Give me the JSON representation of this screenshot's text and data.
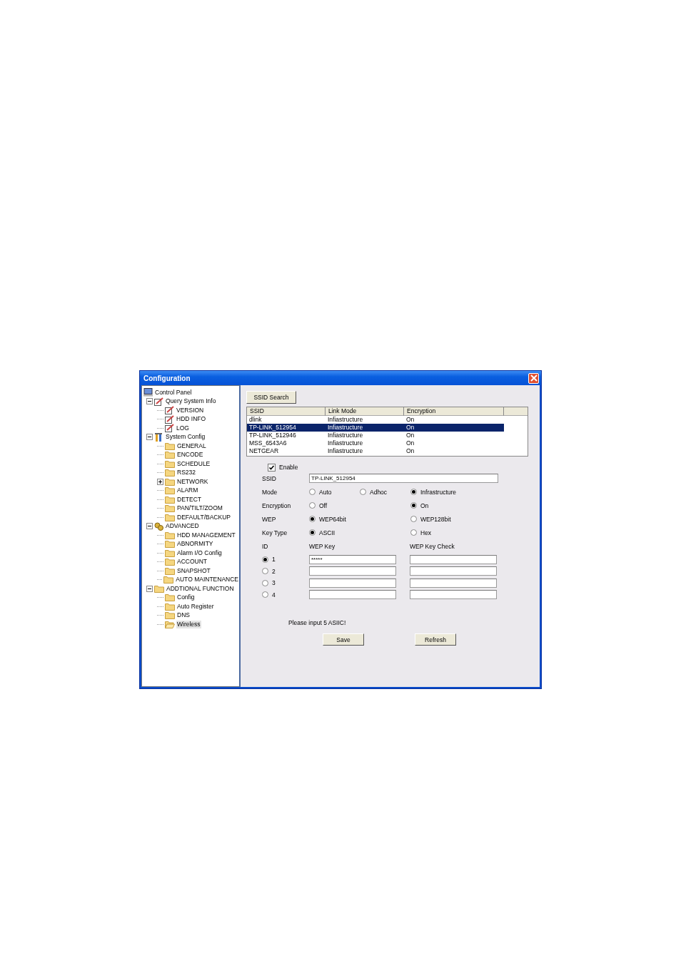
{
  "window": {
    "title": "Configuration"
  },
  "tree": [
    {
      "label": "Control Panel",
      "kind": "monitor",
      "selected": false,
      "children": [
        {
          "label": "Query System Info",
          "kind": "edit",
          "selected": false,
          "expanded": true,
          "children": [
            {
              "label": "VERSION",
              "kind": "edit",
              "selected": false
            },
            {
              "label": "HDD INFO",
              "kind": "edit",
              "selected": false
            },
            {
              "label": "LOG",
              "kind": "edit",
              "selected": false
            }
          ]
        },
        {
          "label": "System Config",
          "kind": "tools",
          "selected": false,
          "expanded": true,
          "children": [
            {
              "label": "GENERAL",
              "kind": "folder",
              "selected": false
            },
            {
              "label": "ENCODE",
              "kind": "folder",
              "selected": false
            },
            {
              "label": "SCHEDULE",
              "kind": "folder",
              "selected": false
            },
            {
              "label": "RS232",
              "kind": "folder",
              "selected": false
            },
            {
              "label": "NETWORK",
              "kind": "folder",
              "selected": false,
              "expanded": false
            },
            {
              "label": "ALARM",
              "kind": "folder",
              "selected": false
            },
            {
              "label": "DETECT",
              "kind": "folder",
              "selected": false
            },
            {
              "label": "PAN/TILT/ZOOM",
              "kind": "folder",
              "selected": false
            },
            {
              "label": "DEFAULT/BACKUP",
              "kind": "folder",
              "selected": false
            }
          ]
        },
        {
          "label": "ADVANCED",
          "kind": "gear",
          "selected": false,
          "expanded": true,
          "children": [
            {
              "label": "HDD MANAGEMENT",
              "kind": "folder",
              "selected": false
            },
            {
              "label": "ABNORMITY",
              "kind": "folder",
              "selected": false
            },
            {
              "label": "Alarm I/O Config",
              "kind": "folder",
              "selected": false
            },
            {
              "label": "ACCOUNT",
              "kind": "folder",
              "selected": false
            },
            {
              "label": "SNAPSHOT",
              "kind": "folder",
              "selected": false
            },
            {
              "label": "AUTO MAINTENANCE",
              "kind": "folder",
              "selected": false
            }
          ]
        },
        {
          "label": "ADDTIONAL FUNCTION",
          "kind": "folder",
          "selected": false,
          "expanded": true,
          "children": [
            {
              "label": "Config",
              "kind": "folder",
              "selected": false
            },
            {
              "label": "Auto Register",
              "kind": "folder",
              "selected": false
            },
            {
              "label": "DNS",
              "kind": "folder",
              "selected": false
            },
            {
              "label": "Wireless",
              "kind": "openfolder",
              "selected": true
            }
          ]
        }
      ]
    }
  ],
  "ssid_search_button": "SSID Search",
  "table": {
    "columns": [
      "SSID",
      "Link Mode",
      "Encryption"
    ],
    "rows": [
      {
        "cells": [
          "dlink",
          "Infiastructure",
          "On"
        ],
        "selected": false
      },
      {
        "cells": [
          "TP-LINK_512954",
          "Infiastructure",
          "On"
        ],
        "selected": true
      },
      {
        "cells": [
          "TP-LINK_512946",
          "Infiastructure",
          "On"
        ],
        "selected": false
      },
      {
        "cells": [
          "MSS_6543A6",
          "Infiastructure",
          "On"
        ],
        "selected": false
      },
      {
        "cells": [
          "NETGEAR",
          "Infiastructure",
          "On"
        ],
        "selected": false
      }
    ]
  },
  "enable": {
    "label": "Enable",
    "checked": true
  },
  "ssid": {
    "label": "SSID",
    "value": "TP-LINK_512954"
  },
  "radio_groups": [
    {
      "label": "Mode",
      "options": [
        {
          "label": "Auto",
          "selected": false
        },
        {
          "label": "Adhoc",
          "selected": false
        },
        {
          "label": "Infrastructure",
          "selected": true
        }
      ]
    },
    {
      "label": "Encryption",
      "options": [
        {
          "label": "Off",
          "selected": false
        },
        {
          "label": "On",
          "selected": true
        }
      ]
    },
    {
      "label": "WEP",
      "options": [
        {
          "label": "WEP64bit",
          "selected": true
        },
        {
          "label": "WEP128bit",
          "selected": false
        }
      ]
    },
    {
      "label": "Key Type",
      "options": [
        {
          "label": "ASCII",
          "selected": true
        },
        {
          "label": "Hex",
          "selected": false
        }
      ]
    }
  ],
  "keys": {
    "columns": [
      "ID",
      "WEP Key",
      "WEP Key Check"
    ],
    "rows": [
      {
        "id": "1",
        "selected": true,
        "wep_key": "*****"
      },
      {
        "id": "2",
        "selected": false
      },
      {
        "id": "3",
        "selected": false
      },
      {
        "id": "4",
        "selected": false
      }
    ]
  },
  "message": "Please input 5 ASIIC!",
  "buttons": [
    "Save",
    "Refresh"
  ]
}
